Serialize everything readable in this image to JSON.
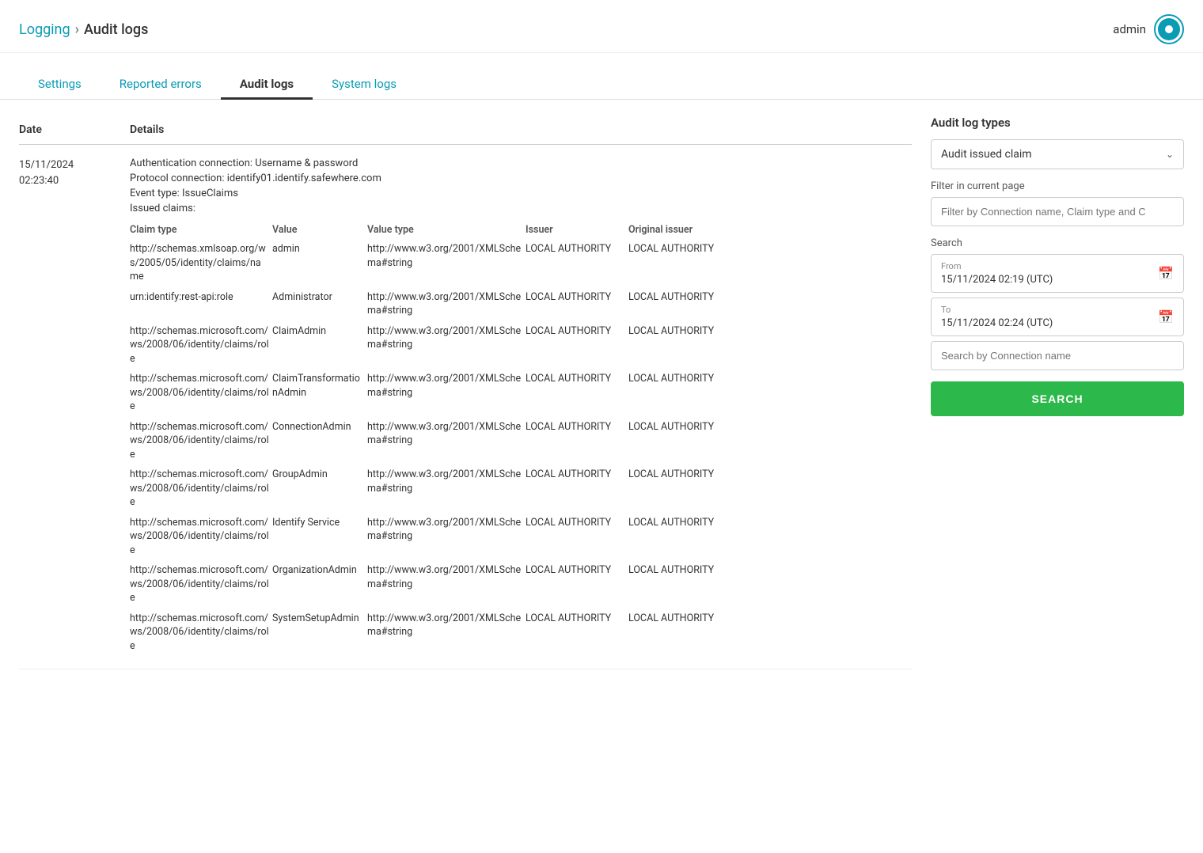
{
  "header": {
    "breadcrumb_logging": "Logging",
    "breadcrumb_sep": "›",
    "breadcrumb_current": "Audit logs",
    "user_name": "admin"
  },
  "tabs": [
    {
      "label": "Settings",
      "active": false
    },
    {
      "label": "Reported errors",
      "active": false
    },
    {
      "label": "Audit logs",
      "active": true
    },
    {
      "label": "System logs",
      "active": false
    }
  ],
  "table": {
    "col_date": "Date",
    "col_details": "Details"
  },
  "log_entry": {
    "date": "15/11/2024\n02:23:40",
    "auth_connection": "Authentication connection: Username & password",
    "protocol_connection": "Protocol connection: identify01.identify.safewhere.com",
    "event_type": "Event type: IssueClaims",
    "issued_claims_label": "Issued claims:",
    "claims_headers": [
      "Claim type",
      "Value",
      "Value type",
      "Issuer",
      "Original issuer"
    ],
    "claims_rows": [
      {
        "claim_type": "http://schemas.xmlsoap.org/ws/2005/05/identity/claims/name",
        "value": "admin",
        "value_type": "http://www.w3.org/2001/XMLSchema#string",
        "issuer": "LOCAL AUTHORITY",
        "original_issuer": "LOCAL AUTHORITY"
      },
      {
        "claim_type": "urn:identify:rest-api:role",
        "value": "Administrator",
        "value_type": "http://www.w3.org/2001/XMLSchema#string",
        "issuer": "LOCAL AUTHORITY",
        "original_issuer": "LOCAL AUTHORITY"
      },
      {
        "claim_type": "http://schemas.microsoft.com/ws/2008/06/identity/claims/role",
        "value": "ClaimAdmin",
        "value_type": "http://www.w3.org/2001/XMLSchema#string",
        "issuer": "LOCAL AUTHORITY",
        "original_issuer": "LOCAL AUTHORITY"
      },
      {
        "claim_type": "http://schemas.microsoft.com/ws/2008/06/identity/claims/role",
        "value": "ClaimTransformationAdmin",
        "value_type": "http://www.w3.org/2001/XMLSchema#string",
        "issuer": "LOCAL AUTHORITY",
        "original_issuer": "LOCAL AUTHORITY"
      },
      {
        "claim_type": "http://schemas.microsoft.com/ws/2008/06/identity/claims/role",
        "value": "ConnectionAdmin",
        "value_type": "http://www.w3.org/2001/XMLSchema#string",
        "issuer": "LOCAL AUTHORITY",
        "original_issuer": "LOCAL AUTHORITY"
      },
      {
        "claim_type": "http://schemas.microsoft.com/ws/2008/06/identity/claims/role",
        "value": "GroupAdmin",
        "value_type": "http://www.w3.org/2001/XMLSchema#string",
        "issuer": "LOCAL AUTHORITY",
        "original_issuer": "LOCAL AUTHORITY"
      },
      {
        "claim_type": "http://schemas.microsoft.com/ws/2008/06/identity/claims/role",
        "value": "Identify Service",
        "value_type": "http://www.w3.org/2001/XMLSchema#string",
        "issuer": "LOCAL AUTHORITY",
        "original_issuer": "LOCAL AUTHORITY"
      },
      {
        "claim_type": "http://schemas.microsoft.com/ws/2008/06/identity/claims/role",
        "value": "OrganizationAdmin",
        "value_type": "http://www.w3.org/2001/XMLSchema#string",
        "issuer": "LOCAL AUTHORITY",
        "original_issuer": "LOCAL AUTHORITY"
      },
      {
        "claim_type": "http://schemas.microsoft.com/ws/2008/06/identity/claims/role",
        "value": "SystemSetupAdmin",
        "value_type": "http://www.w3.org/2001/XMLSchema#string",
        "issuer": "LOCAL AUTHORITY",
        "original_issuer": "LOCAL AUTHORITY"
      }
    ]
  },
  "sidebar": {
    "audit_log_types_title": "Audit log types",
    "dropdown_value": "Audit issued claim",
    "filter_label": "Filter in current page",
    "filter_placeholder": "Filter by Connection name, Claim type and C",
    "search_label": "Search",
    "from_label": "From",
    "from_value": "15/11/2024 02:19 (UTC)",
    "to_label": "To",
    "to_value": "15/11/2024 02:24 (UTC)",
    "connection_placeholder": "Search by Connection name",
    "search_button": "SEARCH"
  }
}
